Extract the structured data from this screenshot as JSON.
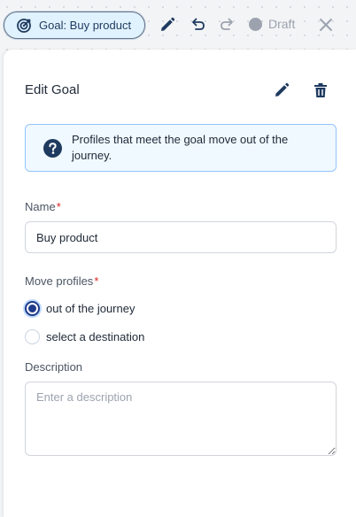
{
  "toolbar": {
    "goal_pill_label": "Goal: Buy product",
    "status_label": "Draft"
  },
  "panel": {
    "title": "Edit Goal",
    "info_text": "Profiles that meet the goal move out of the journey.",
    "name_field": {
      "label": "Name",
      "required_mark": "*",
      "value": "Buy product"
    },
    "move_profiles": {
      "label": "Move profiles",
      "required_mark": "*",
      "options": [
        {
          "label": "out of the journey",
          "selected": true
        },
        {
          "label": "select a destination",
          "selected": false
        }
      ]
    },
    "description": {
      "label": "Description",
      "placeholder": "Enter a description",
      "value": ""
    }
  },
  "colors": {
    "accent": "#1e3a8a",
    "info_background": "#f0f9ff",
    "info_border": "#93c5fd",
    "required": "#dc2626",
    "muted": "#9ca3af"
  },
  "icons": [
    "goal-target-icon",
    "pencil-icon",
    "undo-icon",
    "redo-icon",
    "status-dot-icon",
    "close-icon",
    "edit-icon",
    "trash-icon",
    "question-icon"
  ]
}
